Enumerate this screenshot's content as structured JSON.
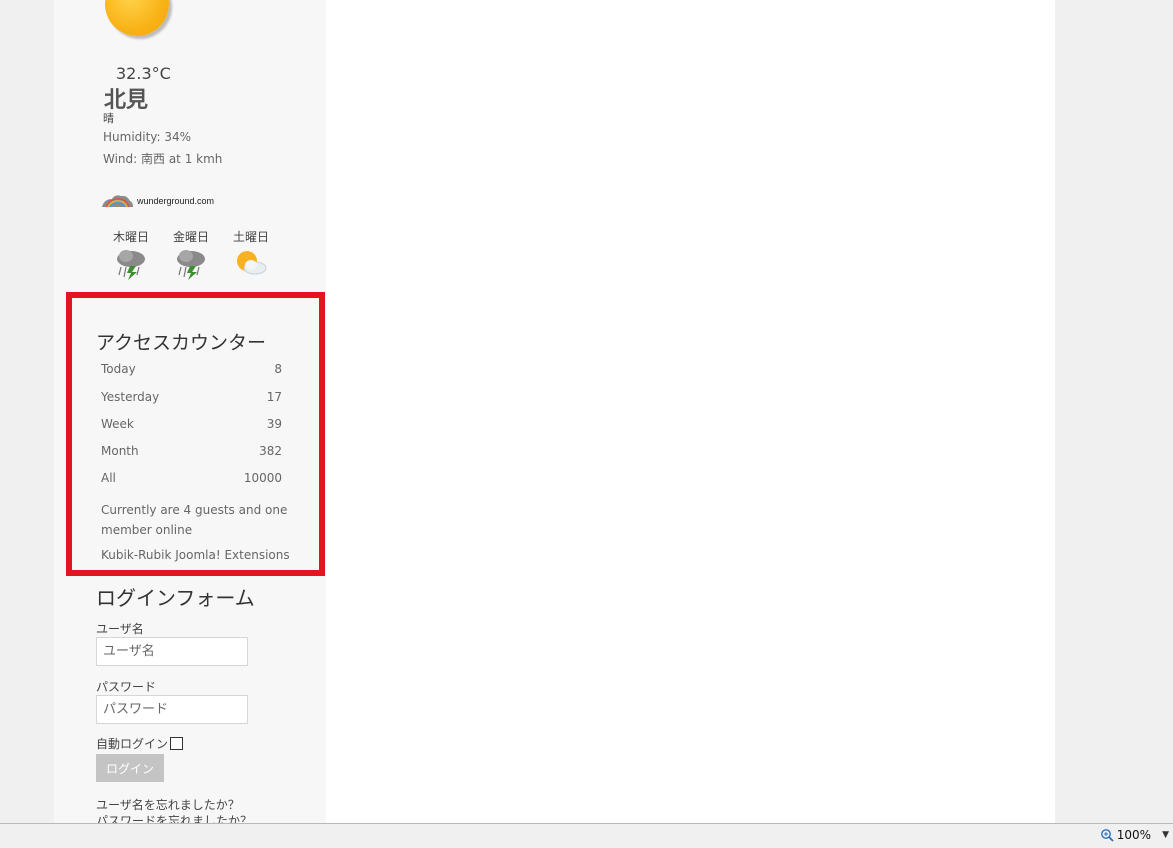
{
  "weather": {
    "temperature": "32.3°C",
    "city": "北見",
    "condition": "晴",
    "humidity": "Humidity: 34%",
    "wind": "Wind: 南西 at 1 kmh",
    "provider": "wunderground.com",
    "forecast": [
      {
        "day": "木曜日",
        "icon": "rain-thunder-icon"
      },
      {
        "day": "金曜日",
        "icon": "rain-thunder-icon"
      },
      {
        "day": "土曜日",
        "icon": "partly-cloudy-icon"
      }
    ]
  },
  "counter": {
    "title": "アクセスカウンター",
    "rows": [
      {
        "label": "Today",
        "value": "8"
      },
      {
        "label": "Yesterday",
        "value": "17"
      },
      {
        "label": "Week",
        "value": "39"
      },
      {
        "label": "Month",
        "value": "382"
      },
      {
        "label": "All",
        "value": "10000"
      }
    ],
    "online": "Currently are 4 guests and one member online",
    "extension": "Kubik-Rubik Joomla! Extensions",
    "highlight_color": "#e3141f"
  },
  "login": {
    "title": "ログインフォーム",
    "username_label": "ユーザ名",
    "username_placeholder": "ユーザ名",
    "password_label": "パスワード",
    "password_placeholder": "パスワード",
    "remember_label": "自動ログイン",
    "submit_label": "ログイン",
    "forgot_username": "ユーザ名を忘れましたか？",
    "forgot_password": "パスワードを忘れましたか？"
  },
  "statusbar": {
    "zoom": "100%"
  }
}
